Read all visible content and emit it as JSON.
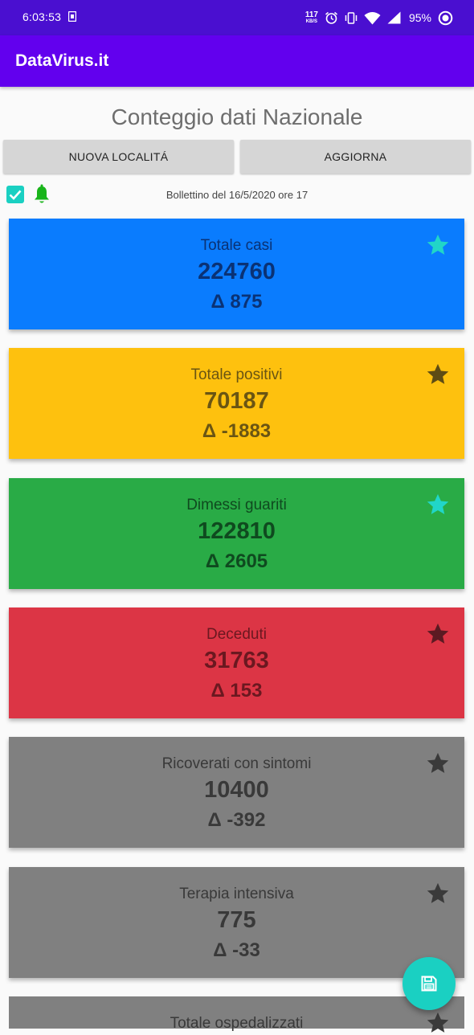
{
  "status_bar": {
    "time": "6:03:53",
    "net_speed": "117",
    "net_speed_unit": "KB/S",
    "battery": "95%"
  },
  "app_bar": {
    "title": "DataVirus.it"
  },
  "page": {
    "title": "Conteggio dati Nazionale",
    "new_location_label": "NUOVA LOCALITÁ",
    "refresh_label": "AGGIORNA",
    "notifications_checked": true,
    "bulletin": "Bollettino del 16/5/2020 ore 17"
  },
  "colors": {
    "app_bar": "#6200ee",
    "status_bar": "#4a0fd0",
    "accent": "#1ad0c2",
    "bell": "#18b41a"
  },
  "cards": [
    {
      "label": "Totale casi",
      "value": "224760",
      "delta": "Δ 875",
      "starred": true,
      "bg": "#0a7cfe",
      "fg": "#0a3275",
      "star_color": "#21d6c8"
    },
    {
      "label": "Totale positivi",
      "value": "70187",
      "delta": "Δ -1883",
      "starred": false,
      "bg": "#fec10e",
      "fg": "#6a5513",
      "star_color": "#5e4c14"
    },
    {
      "label": "Dimessi guariti",
      "value": "122810",
      "delta": "Δ 2605",
      "starred": true,
      "bg": "#29ab46",
      "fg": "#0f4a1f",
      "star_color": "#21d6c8"
    },
    {
      "label": "Deceduti",
      "value": "31763",
      "delta": "Δ 153",
      "starred": false,
      "bg": "#dc3545",
      "fg": "#6b1820",
      "star_color": "#5c1a22"
    },
    {
      "label": "Ricoverati con sintomi",
      "value": "10400",
      "delta": "Δ -392",
      "starred": false,
      "bg": "#808080",
      "fg": "#393939",
      "star_color": "#3a3a3a"
    },
    {
      "label": "Terapia intensiva",
      "value": "775",
      "delta": "Δ -33",
      "starred": false,
      "bg": "#808080",
      "fg": "#393939",
      "star_color": "#3a3a3a"
    },
    {
      "label": "Totale ospedalizzati",
      "value": "",
      "delta": "",
      "starred": false,
      "bg": "#808080",
      "fg": "#393939",
      "star_color": "#3a3a3a"
    }
  ],
  "fab": {
    "icon": "save-icon"
  }
}
